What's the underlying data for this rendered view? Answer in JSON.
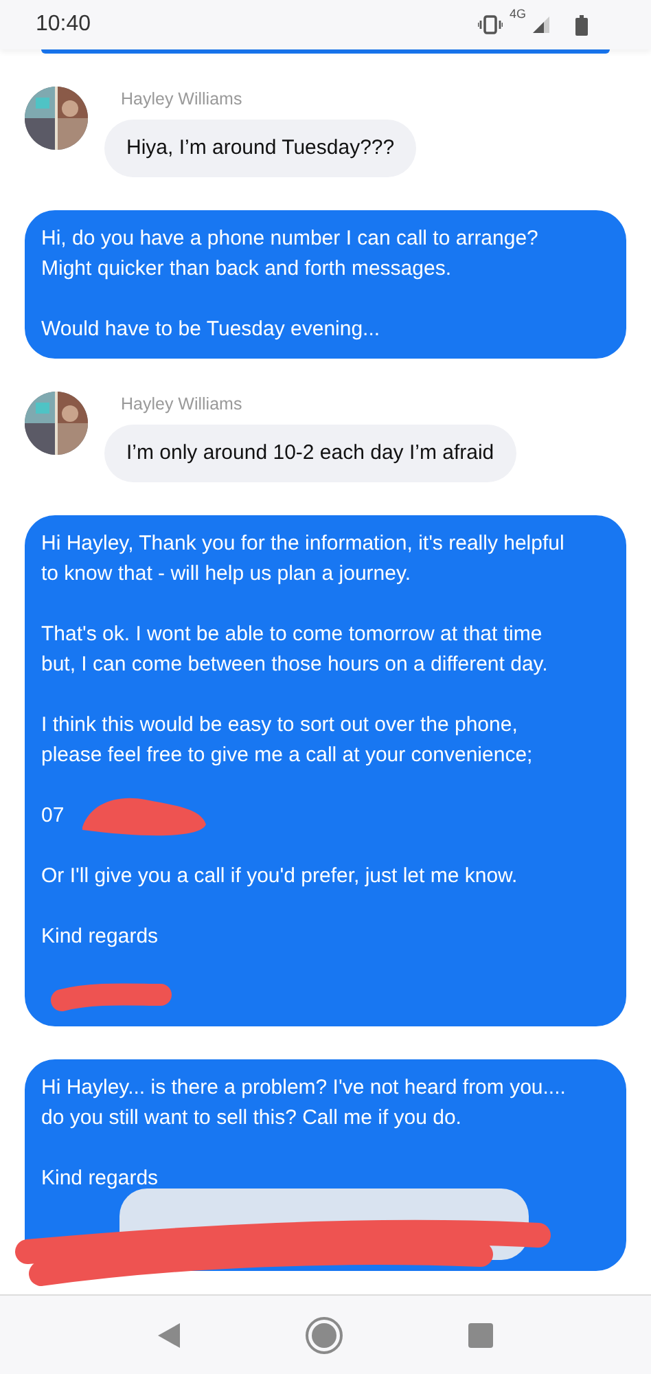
{
  "status_bar": {
    "time": "10:40",
    "network": "4G"
  },
  "messages": [
    {
      "kind": "sent_edge"
    },
    {
      "kind": "received",
      "sender": "Hayley Williams",
      "text": "Hiya, I’m around Tuesday???"
    },
    {
      "kind": "sent",
      "paragraphs": [
        {
          "kind": "text",
          "lines": [
            "Hi, do you have a phone number I can call to arrange?",
            "Might quicker than back and forth messages."
          ]
        },
        {
          "kind": "text",
          "lines": [
            "Would have to be Tuesday evening..."
          ]
        }
      ]
    },
    {
      "kind": "received",
      "sender": "Hayley Williams",
      "text": "I’m only around 10-2 each day I’m afraid"
    },
    {
      "kind": "sent",
      "paragraphs": [
        {
          "kind": "text",
          "lines": [
            "Hi Hayley, Thank you for the information, it's really helpful",
            "to know that - will help us plan a journey."
          ]
        },
        {
          "kind": "text",
          "lines": [
            "That's ok. I wont be able to come tomorrow at that time",
            "but, I can come between those hours on a different day."
          ]
        },
        {
          "kind": "text",
          "lines": [
            "I think this would be easy to sort out over the phone,",
            "please feel free to give me a call at your convenience;"
          ]
        },
        {
          "kind": "text",
          "lines": [
            "07"
          ],
          "redacted": true
        },
        {
          "kind": "text",
          "lines": [
            "Or I'll give you a call if you'd prefer, just let me know."
          ]
        },
        {
          "kind": "text",
          "lines": [
            "Kind regards"
          ]
        },
        {
          "kind": "redaction"
        }
      ]
    },
    {
      "kind": "sent",
      "popup": true,
      "redacted": true,
      "paragraphs": [
        {
          "kind": "text",
          "lines": [
            "Hi Hayley... is there a problem? I've not heard from you....",
            "do you still want to sell this? Call me if you do."
          ]
        },
        {
          "kind": "text",
          "lines": [
            "Kind regards"
          ]
        }
      ]
    }
  ]
}
